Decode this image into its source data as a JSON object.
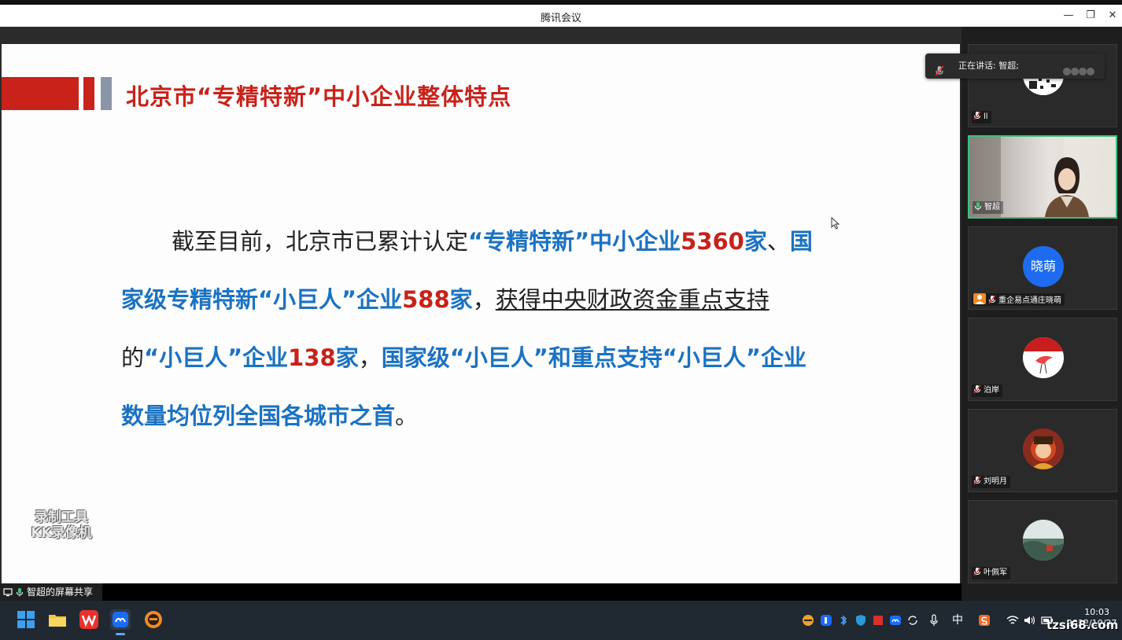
{
  "window": {
    "title": "腾讯会议",
    "minimize": "—",
    "restore": "❐",
    "close": "✕"
  },
  "slide": {
    "title": "北京市“专精特新”中小企业整体特点",
    "p_intro": "截至目前，北京市已累计认定",
    "p_b1": "“专精特新”中小企业",
    "p_r1": "5360",
    "p_b2": "家",
    "p_sep1": "、",
    "p_b3": "国家级专精特新“小巨人”企业",
    "p_r2": "588",
    "p_b4": "家",
    "p_sep2": "，",
    "p_u1": "获得中央财政资金重点支持",
    "p_plain2": "的",
    "p_b5": "“小巨人”企业",
    "p_r3": "138",
    "p_b6": "家",
    "p_sep3": "，",
    "p_b7": "国家级“小巨人”和重点支持“小巨人”企业数量均位列全国各城市之首",
    "p_end": "。",
    "watermark_line1": "录制工具",
    "watermark_line2": "KK录像机"
  },
  "share_label": "智超的屏幕共享",
  "speaking": {
    "text": "正在讲话: 智超;"
  },
  "participants": [
    {
      "name": "ll",
      "avatar": "qr-code-avatar",
      "active": false
    },
    {
      "name": "智超",
      "avatar": "video-feed",
      "active": true
    },
    {
      "name": "重企易点通庄晓萌",
      "avatar_text": "晓萌",
      "active": false
    },
    {
      "name": "泊岸",
      "avatar": "crane-avatar",
      "active": false
    },
    {
      "name": "刘明月",
      "avatar": "child-avatar",
      "active": false
    },
    {
      "name": "叶佩军",
      "avatar": "landscape-avatar",
      "active": false
    }
  ],
  "taskbar": {
    "ime": "中",
    "clock_time": "10:03",
    "clock_date": "2022/10/27"
  },
  "site_watermark": "tzsi68.com",
  "colors": {
    "accent_red": "#c8221a",
    "accent_blue": "#1b72c2",
    "active_border": "#3fbf7a"
  }
}
